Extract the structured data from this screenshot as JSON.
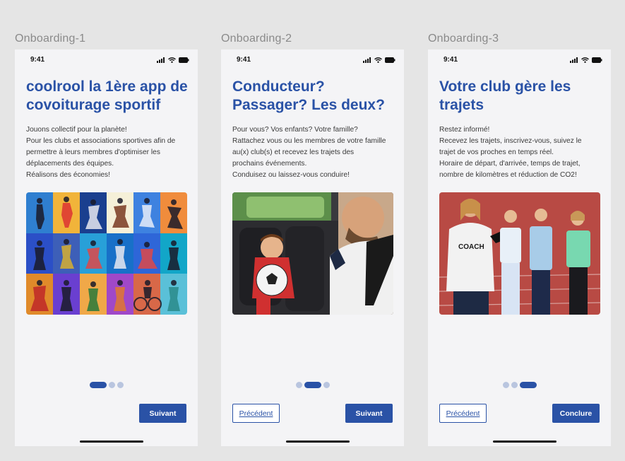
{
  "screens": [
    {
      "label": "Onboarding-1",
      "time": "9:41",
      "title_lines": [
        "coolrool la 1ère app de",
        "covoiturage sportif"
      ],
      "body_lines": [
        "Jouons collectif pour la planète!",
        "Pour les clubs et associations sportives afin de",
        "permettre à leurs membres d'optimiser les",
        "déplacements des équipes.",
        "Réalisons des économies!"
      ],
      "image": "sports-athletes-collage",
      "next_label": "Suivant"
    },
    {
      "label": "Onboarding-2",
      "time": "9:41",
      "title_lines": [
        "Conducteur?",
        "Passager? Les deux?"
      ],
      "body_lines": [
        "Pour vous? Vos enfants? Votre famille?",
        "Rattachez vous ou les membres de votre famille",
        "au(x) club(s) et recevez les trajets des",
        "prochains événements.",
        "Conduisez ou laissez-vous conduire!"
      ],
      "image": "child-with-football-in-car",
      "prev_label": "Précédent",
      "next_label": "Suivant"
    },
    {
      "label": "Onboarding-3",
      "time": "9:41",
      "title_lines": [
        "Votre club gère les",
        "trajets"
      ],
      "body_lines": [
        "Restez informé!",
        "Recevez les trajets, inscrivez-vous, suivez le",
        "trajet de vos proches en temps réel.",
        "Horaire de départ, d'arrivée, temps de trajet,",
        "nombre de kilomètres et réduction de CO2!"
      ],
      "image": "coach-with-kids-on-track",
      "coach_text": "COACH",
      "prev_label": "Précédent",
      "next_label": "Conclure"
    }
  ],
  "colors": {
    "accent": "#2a52a6",
    "dot_inactive": "#b9c5df",
    "screen_bg": "#f4f4f6",
    "canvas_bg": "#e5e5e5"
  }
}
